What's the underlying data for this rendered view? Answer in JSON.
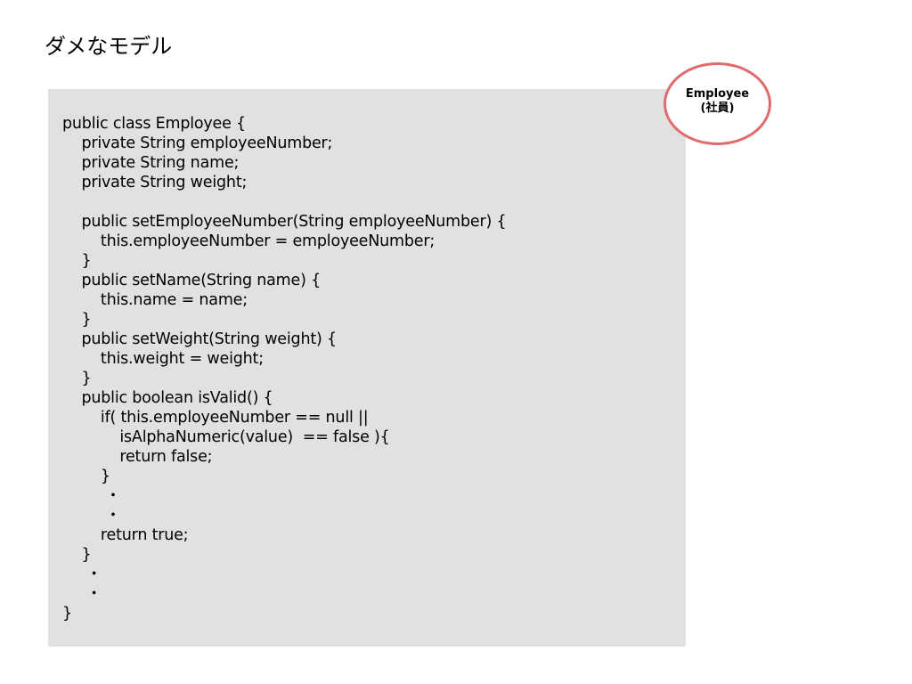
{
  "slide": {
    "title": "ダメなモデル"
  },
  "badge": {
    "line1": "Employee",
    "line2": "(社員)"
  },
  "colors": {
    "code_background": "#e1e1e1",
    "badge_border": "#e06b6d"
  },
  "code": {
    "lines": [
      "public class Employee {",
      "    private String employeeNumber;",
      "    private String name;",
      "    private String weight;",
      "",
      "    public setEmployeeNumber(String employeeNumber) {",
      "        this.employeeNumber = employeeNumber;",
      "    }",
      "    public setName(String name) {",
      "        this.name = name;",
      "    }",
      "    public setWeight(String weight) {",
      "        this.weight = weight;",
      "    }",
      "    public boolean isValid() {",
      "        if( this.employeeNumber == null ||",
      "            isAlphaNumeric(value)  == false ){",
      "            return false;",
      "        }",
      "         ・",
      "         ・",
      "        return true;",
      "    }",
      "     ・",
      "     ・",
      "}"
    ]
  }
}
